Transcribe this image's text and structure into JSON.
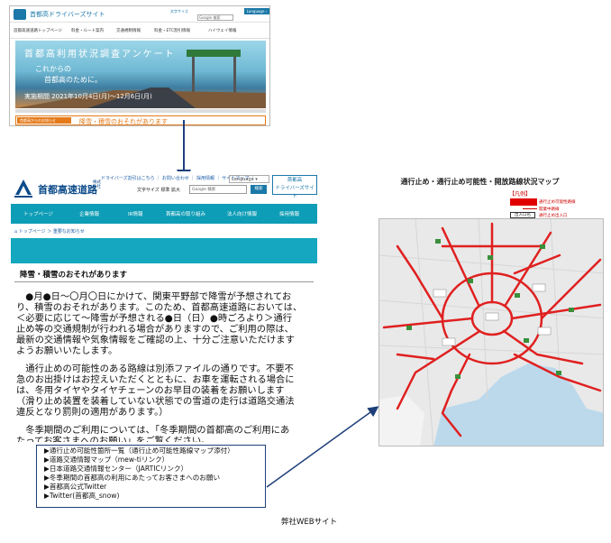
{
  "top_shot": {
    "site_title": "首都高ドライバーズサイト",
    "header_links": [
      "文字サイズ",
      "Google 検索",
      "Language ›"
    ],
    "nav_items": [
      "首都高速道路トップページ",
      "料金・ルート案内",
      "交通規制情報",
      "料金・ETC割引情報",
      "ハイウェイ情報"
    ],
    "banner_title": "首都高利用状況調査アンケート",
    "banner_line1": "これからの",
    "banner_line2": "首都高のために。",
    "banner_period": "実施期間 2021年10月4日(月)～12月6日(月)",
    "alert_tag": "首都高からのお知らせ",
    "alert_message": "降雪・積雪のおそれがあります"
  },
  "page": {
    "logo_text": "首都高速道路",
    "logo_sub": "株式会社",
    "top_links": "ドライバーズ割引はこちら ｜ お問い合わせ ｜ 採用情報 ｜ サイトマップ ｜",
    "language": "Language ▾",
    "driver_button_line1": "首都高",
    "driver_button_line2": "ドライバーズサイト",
    "font_size_label": "文字サイズ  標準  拡大",
    "search_placeholder": "Google 検索",
    "search_button": "検索",
    "nav": [
      "トップページ",
      "企業情報",
      "IR情報",
      "首都高の取り組み",
      "法人向け情報",
      "採用情報"
    ],
    "breadcrumb": "⌂ トップページ ＞ 重要なお知らせ",
    "heading": "降雪・積雪のおそれがあります",
    "paragraphs": [
      "　●月●日～〇月〇日にかけて、関東平野部で降雪が予想されてお",
      "り、積雪のおそれがあります。このため、首都高速道路においては、",
      "＜必要に応じて～降雪が予想される●日（日）●時ごろより＞通行",
      "止め等の交通規制が行われる場合がありますので、ご利用の際は、",
      "最新の交通情報や気象情報をご確認の上、十分ご注意いただけます",
      "ようお願いいたします。",
      "",
      "　通行止めの可能性のある路線は別添ファイルの通りです。不要不",
      "急のお出掛けはお控えいただくとともに、お車を運転される場合に",
      "は、冬用タイヤやタイヤチェーンのお早目の装着をお願いします",
      "（滑り止め装置を装着していない状態での雪道の走行は道路交通法",
      "違反となり罰則の適用があります。）",
      "",
      "　冬季期間のご利用については、「冬季期間の首都高のご利用にあ",
      "たってお客さまへのお願い」をご覧ください。"
    ]
  },
  "links": [
    "▶通行止め可能性箇所一覧（通行止め可能性路線マップ添付）",
    "▶道路交通情報マップ（mew-tiリンク）",
    "▶日本道路交通情報センター（JARTICリンク）",
    "▶冬季期間の首都高の利用にあたってお客さまへのお願い",
    "▶首都高公式Twitter",
    "▶Twitter(首都高_snow)"
  ],
  "map": {
    "title": "通行止め・通行止め可能性・開放路線状況マップ",
    "legend_title": "【凡例】",
    "legend": [
      "通行止め可能性路線",
      "開業中路線",
      "通行止め出入口"
    ],
    "legend_box_label": "出入口名"
  },
  "caption": "弊社WEBサイト",
  "colors": {
    "accent": "#0e9db6",
    "alert": "#e47a1a",
    "route": "#e02020",
    "frame": "#1f3f7a",
    "sea": "#bcd9ec"
  }
}
